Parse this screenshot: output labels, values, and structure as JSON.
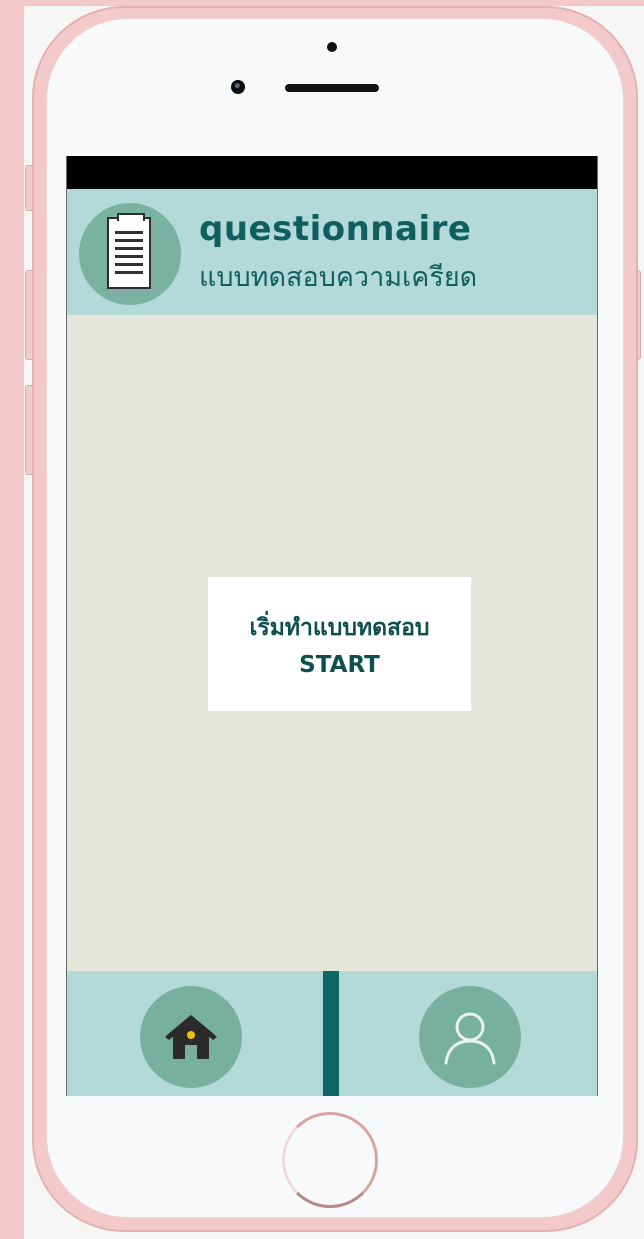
{
  "header": {
    "title": "questionnaire",
    "subtitle": "แบบทดสอบความเครียด",
    "icon": "document-icon"
  },
  "main": {
    "start_button": {
      "label_th": "เริ่มทำแบบทดสอบ",
      "label_en": "START"
    }
  },
  "bottom_nav": {
    "items": [
      {
        "name": "home",
        "icon": "home-icon"
      },
      {
        "name": "profile",
        "icon": "user-icon"
      }
    ]
  },
  "colors": {
    "header_bg": "#b4d9d9",
    "accent": "#0f5f5e",
    "content_bg": "#e5e6db",
    "avatar_bg": "#79b2a1",
    "phone_frame": "#f3c9c9"
  }
}
